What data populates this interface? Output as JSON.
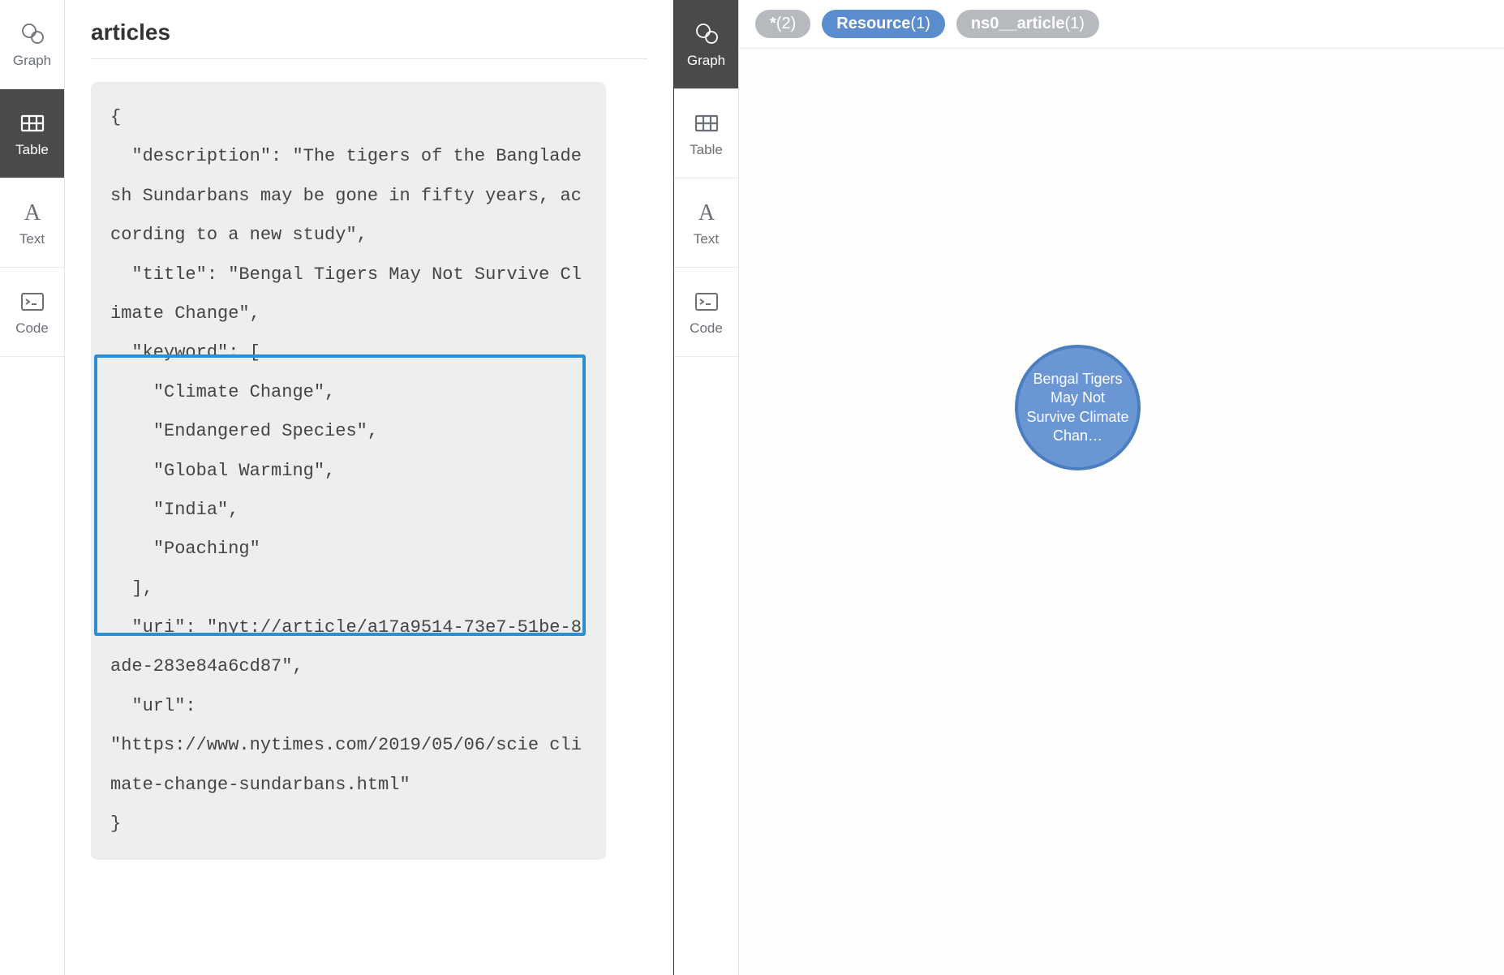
{
  "left": {
    "sidebar": [
      {
        "id": "graph",
        "label": "Graph"
      },
      {
        "id": "table",
        "label": "Table"
      },
      {
        "id": "text",
        "label": "Text"
      },
      {
        "id": "code",
        "label": "Code"
      }
    ],
    "active": "table",
    "title": "articles",
    "json_record": {
      "description": "The tigers of the Bangladesh Sundarbans may be gone in fifty years, according to a new study",
      "title": "Bengal Tigers May Not Survive Climate Change",
      "keyword": [
        "Climate Change",
        "Endangered Species",
        "Global Warming",
        "India",
        "Poaching"
      ],
      "uri": "nyt://article/a17a9514-73e7-51be-8ade-283e84a6cd87",
      "url": "https://www.nytimes.com/2019/05/06/scie climate-change-sundarbans.html"
    },
    "highlight_lines": {
      "start": 5,
      "end": 12
    }
  },
  "right": {
    "sidebar": [
      {
        "id": "graph",
        "label": "Graph"
      },
      {
        "id": "table",
        "label": "Table"
      },
      {
        "id": "text",
        "label": "Text"
      },
      {
        "id": "code",
        "label": "Code"
      }
    ],
    "active": "graph",
    "chips": [
      {
        "label": "*",
        "count": 2,
        "colorClass": "grey"
      },
      {
        "label": "Resource",
        "count": 1,
        "colorClass": "blue"
      },
      {
        "label": "ns0__article",
        "count": 1,
        "colorClass": "grey"
      }
    ],
    "node": {
      "text": "Bengal Tigers May Not Survive Climate Chan…"
    }
  }
}
